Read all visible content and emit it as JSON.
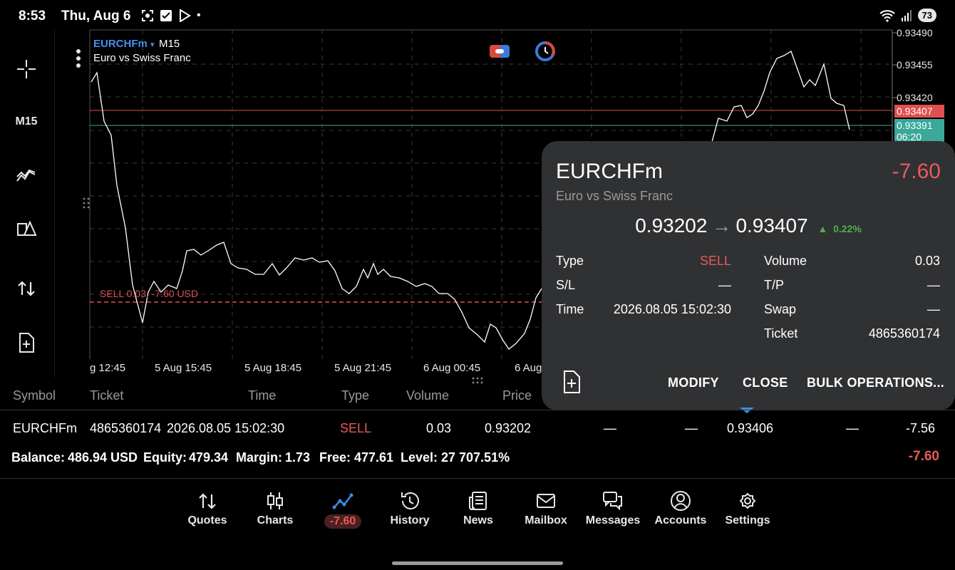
{
  "status_bar": {
    "time": "8:53",
    "date": "Thu, Aug 6",
    "battery": "73",
    "dot": "•"
  },
  "left_toolbar": {
    "timeframe": "M15",
    "icons": [
      "crosshair-icon",
      "indicators-icon",
      "objects-icon",
      "trade-icon",
      "new-order-icon"
    ]
  },
  "chart": {
    "symbol": "EURCHFm",
    "symbol_caret": "▾",
    "timeframe": "M15",
    "description": "Euro vs Swiss Franc",
    "sell_line_label": "SELL 0.03,  -7.60 USD",
    "price_axis": [
      "0.93490",
      "0.93455",
      "0.93420"
    ],
    "ask_tag": "0.93407",
    "bid_tag": "0.93391",
    "bid_timer": "06:20",
    "time_axis": [
      "g 12:45",
      "5 Aug 15:45",
      "5 Aug 18:45",
      "5 Aug 21:45",
      "6 Aug 00:45",
      "6 Aug"
    ],
    "colors": {
      "symbol": "#4a8ff0",
      "ask_line": "#e05050",
      "bid_line": "#3aa89a",
      "sell_line": "#e05050",
      "grid": "#3a3a3a",
      "price_line": "#ffffff"
    }
  },
  "popup": {
    "symbol": "EURCHFm",
    "profit": "-7.60",
    "description": "Euro vs Swiss Franc",
    "open_price": "0.93202",
    "arrow": "→",
    "current_price": "0.93407",
    "change_arrow": "▲",
    "change": "0.22%",
    "left_fields": [
      {
        "label": "Type",
        "value": "SELL"
      },
      {
        "label": "S/L",
        "value": "—"
      },
      {
        "label": "Time",
        "value": "2026.08.05 15:02:30"
      }
    ],
    "right_fields": [
      {
        "label": "Volume",
        "value": "0.03"
      },
      {
        "label": "T/P",
        "value": "—"
      },
      {
        "label": "Swap",
        "value": "—"
      },
      {
        "label": "Ticket",
        "value": "4865360174"
      }
    ],
    "buttons": {
      "modify": "MODIFY",
      "close": "CLOSE",
      "bulk": "BULK OPERATIONS..."
    }
  },
  "table": {
    "headers": [
      "Symbol",
      "Ticket",
      "Time",
      "Type",
      "Volume",
      "Price"
    ],
    "row": {
      "symbol": "EURCHFm",
      "ticket": "4865360174",
      "time": "2026.08.05 15:02:30",
      "type": "SELL",
      "volume": "0.03",
      "price": "0.93202",
      "sl": "—",
      "tp": "—",
      "current": "0.93406",
      "swap": "—",
      "profit": "-7.56"
    }
  },
  "account": {
    "balance_label": "Balance:",
    "balance": "486.94 USD",
    "equity_label": "Equity:",
    "equity": "479.34",
    "margin_label": "Margin:",
    "margin": "1.73",
    "free_label": "Free:",
    "free": "477.61",
    "level_label": "Level:",
    "level": "27 707.51%",
    "total": "-7.60"
  },
  "bottom_nav": {
    "quotes": "Quotes",
    "charts": "Charts",
    "trade_badge": "-7.60",
    "history": "History",
    "news": "News",
    "mailbox": "Mailbox",
    "messages": "Messages",
    "accounts": "Accounts",
    "settings": "Settings",
    "active": "trade"
  }
}
